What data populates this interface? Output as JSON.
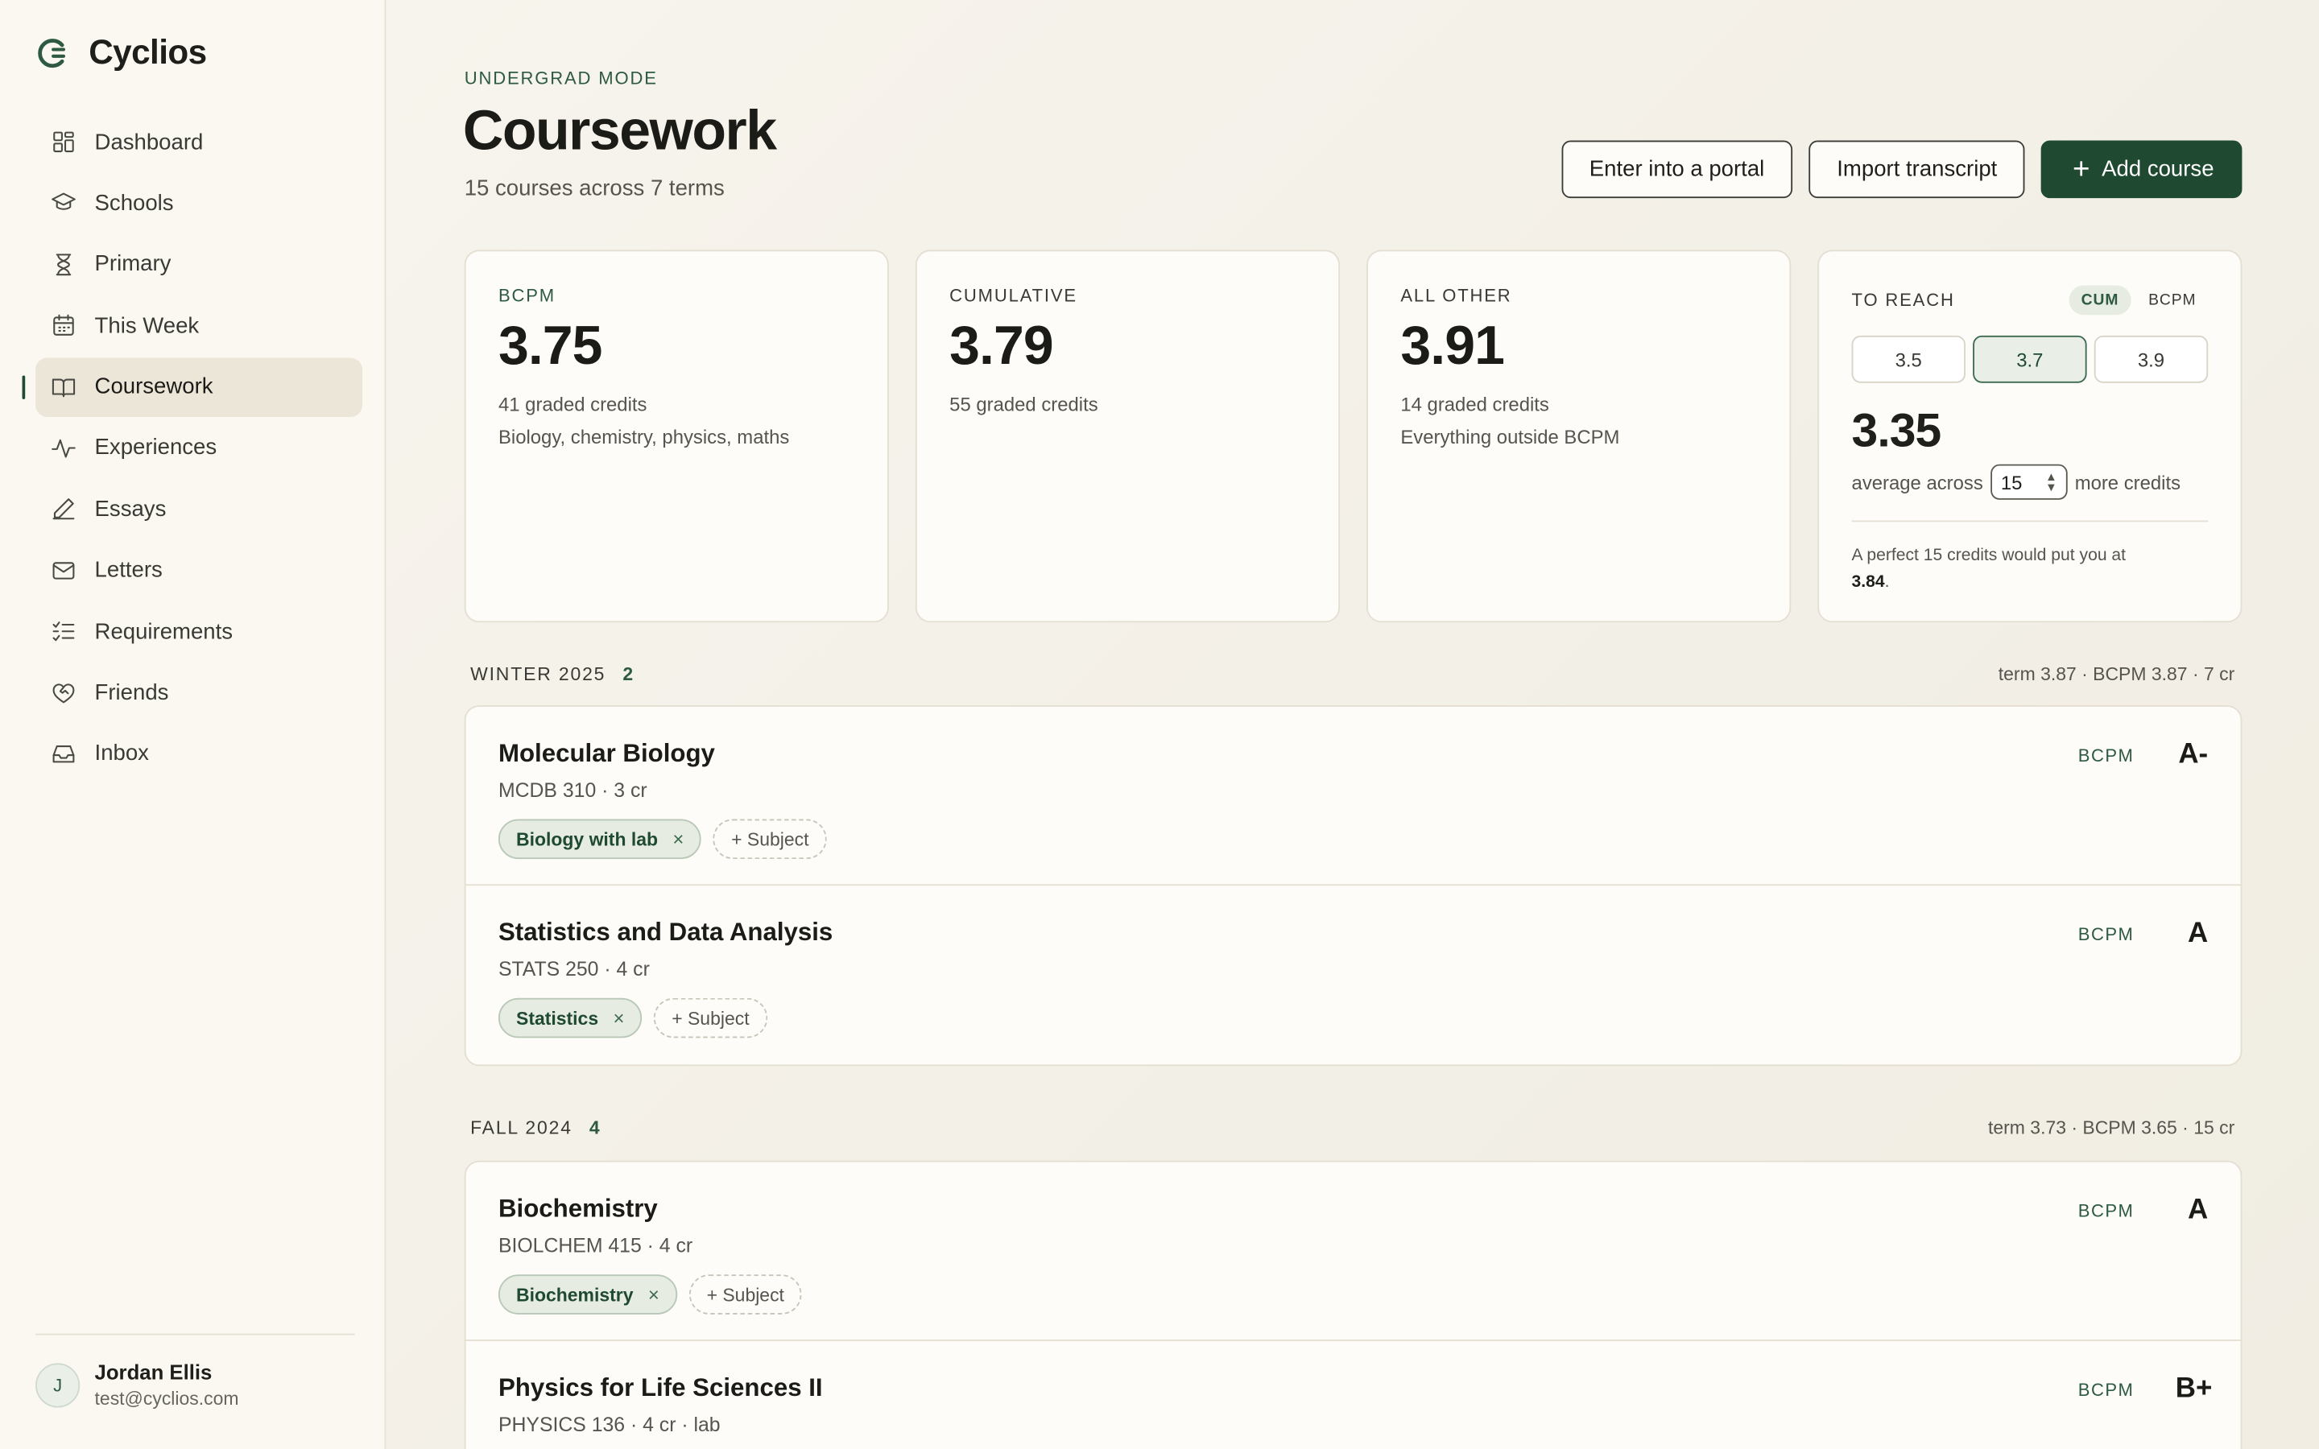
{
  "brand": {
    "name": "Cyclios"
  },
  "nav": [
    {
      "label": "Dashboard",
      "icon": "grid-icon"
    },
    {
      "label": "Schools",
      "icon": "graduation-cap-icon"
    },
    {
      "label": "Primary",
      "icon": "hourglass-icon"
    },
    {
      "label": "This Week",
      "icon": "calendar-icon"
    },
    {
      "label": "Coursework",
      "icon": "book-open-icon",
      "active": true
    },
    {
      "label": "Experiences",
      "icon": "activity-icon"
    },
    {
      "label": "Essays",
      "icon": "pencil-icon"
    },
    {
      "label": "Letters",
      "icon": "mail-icon"
    },
    {
      "label": "Requirements",
      "icon": "checklist-icon"
    },
    {
      "label": "Friends",
      "icon": "heart-handshake-icon"
    },
    {
      "label": "Inbox",
      "icon": "inbox-icon"
    }
  ],
  "user": {
    "initial": "J",
    "name": "Jordan Ellis",
    "email": "test@cyclios.com"
  },
  "header": {
    "mode": "UNDERGRAD MODE",
    "title": "Coursework",
    "subtitle": "15 courses across 7 terms",
    "portal_label": "Enter into a portal",
    "import_label": "Import transcript",
    "add_label": "Add course"
  },
  "stats": [
    {
      "label": "BCPM",
      "value": "3.75",
      "note1": "41 graded credits",
      "note2": "Biology, chemistry, physics, maths"
    },
    {
      "label": "CUMULATIVE",
      "value": "3.79",
      "note1": "55 graded credits",
      "note2": ""
    },
    {
      "label": "ALL OTHER",
      "value": "3.91",
      "note1": "14 graded credits",
      "note2": "Everything outside BCPM"
    }
  ],
  "reach": {
    "label": "TO REACH",
    "toggle": [
      "CUM",
      "BCPM"
    ],
    "targets": [
      "3.5",
      "3.7",
      "3.9"
    ],
    "selected_target": "3.7",
    "value": "3.35",
    "prefix": "average across",
    "credits": "15",
    "suffix": "more credits",
    "note_text": "A perfect 15 credits would put you at",
    "note_value": "3.84",
    "note_end": "."
  },
  "terms": [
    {
      "name": "WINTER 2025",
      "count": "2",
      "summary": "term 3.87 · BCPM 3.87 · 7 cr",
      "courses": [
        {
          "title": "Molecular Biology",
          "meta": "MCDB 310 · 3 cr",
          "subject": "Biology with lab",
          "category": "BCPM",
          "grade": "A-"
        },
        {
          "title": "Statistics and Data Analysis",
          "meta": "STATS 250 · 4 cr",
          "subject": "Statistics",
          "category": "BCPM",
          "grade": "A"
        }
      ]
    },
    {
      "name": "FALL 2024",
      "count": "4",
      "summary": "term 3.73 · BCPM 3.65 · 15 cr",
      "courses": [
        {
          "title": "Biochemistry",
          "meta": "BIOLCHEM 415 · 4 cr",
          "subject": "Biochemistry",
          "category": "BCPM",
          "grade": "A"
        },
        {
          "title": "Physics for Life Sciences II",
          "meta": "PHYSICS 136 · 4 cr · lab",
          "subject": "",
          "category": "BCPM",
          "grade": "B+"
        }
      ]
    }
  ],
  "add_subject_label": "+ Subject",
  "remove_glyph": "×",
  "colors": {
    "accent": "#1f4a31",
    "background": "#f4f1e9",
    "sidebar": "#faf8f1"
  }
}
